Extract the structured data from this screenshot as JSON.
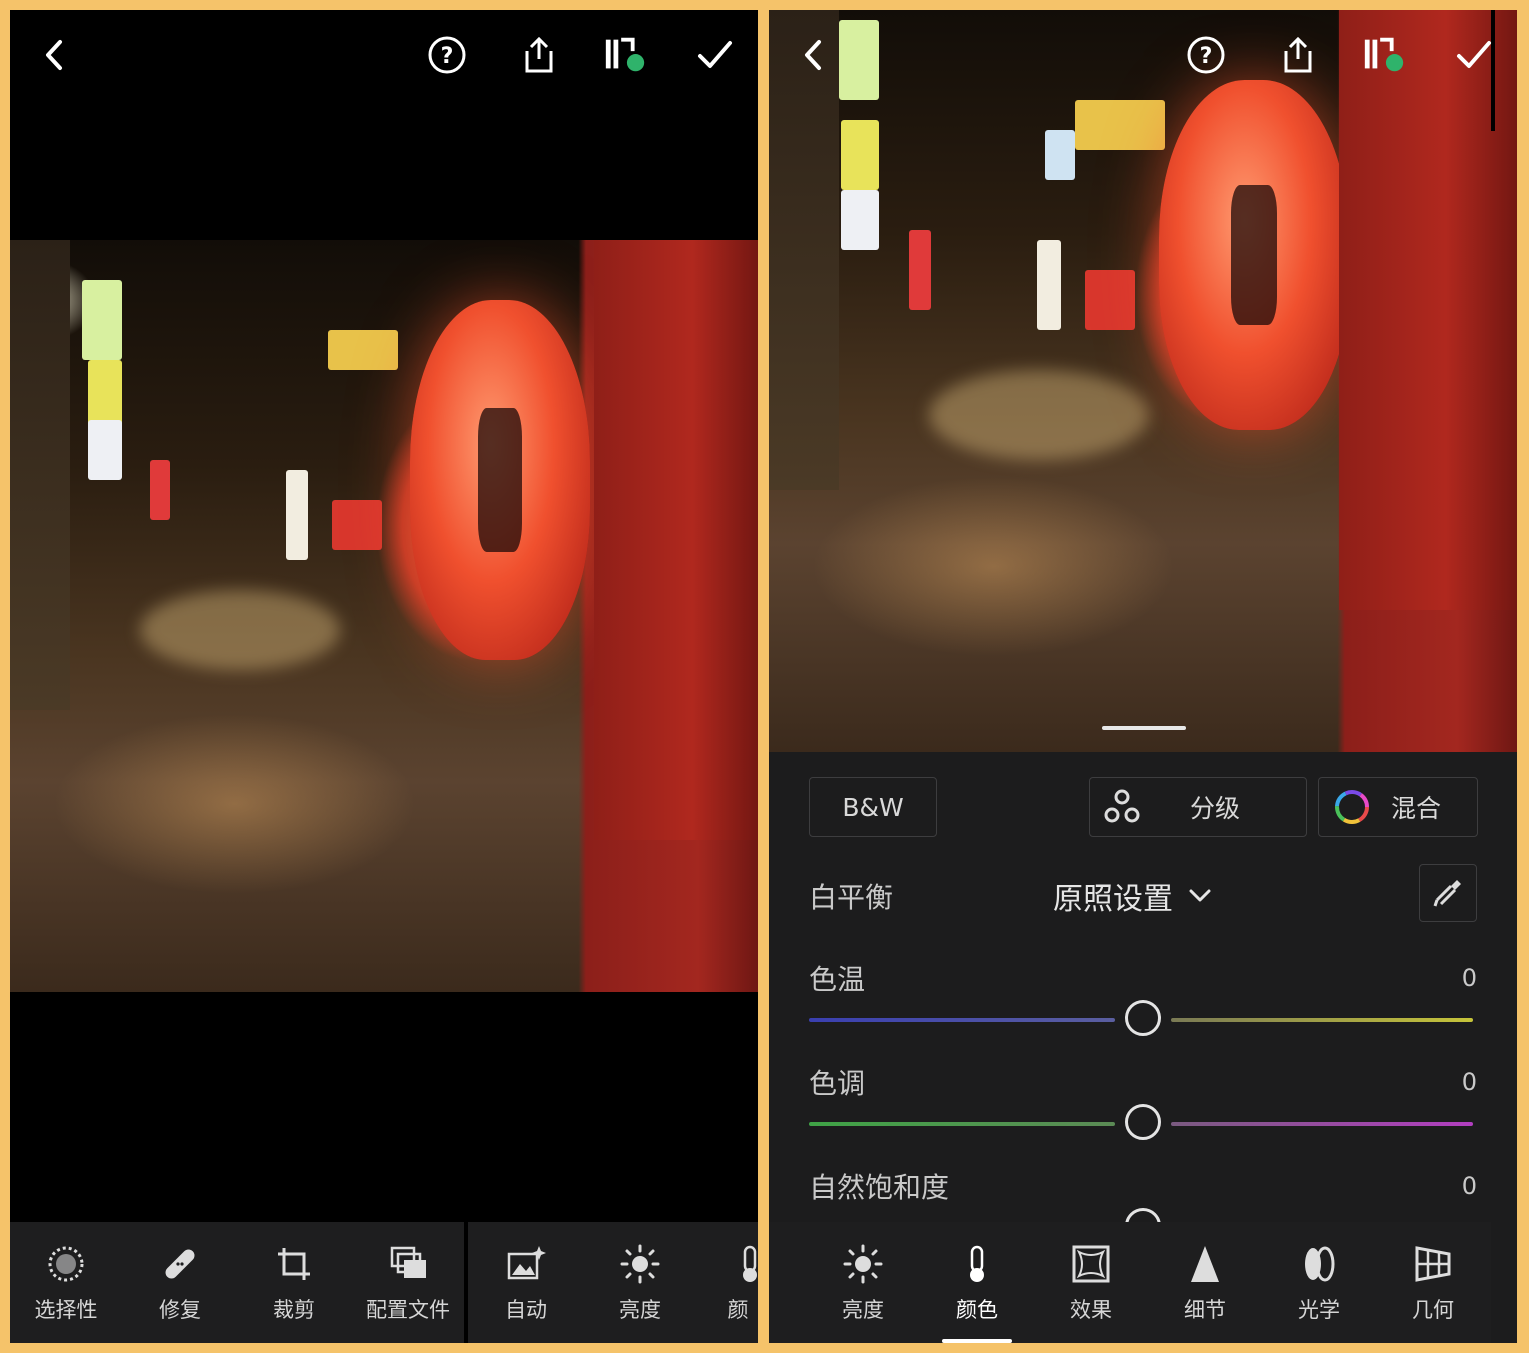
{
  "left": {
    "topbar": {
      "back_icon": "chevron-left-icon",
      "help_icon": "help-circle-icon",
      "share_icon": "share-icon",
      "compare_icon": "versions-icon",
      "confirm_icon": "checkmark-icon"
    },
    "tools": [
      {
        "label": "选择性",
        "icon": "selective-icon"
      },
      {
        "label": "修复",
        "icon": "bandage-icon"
      },
      {
        "label": "裁剪",
        "icon": "crop-icon"
      },
      {
        "label": "配置文件",
        "icon": "profiles-icon"
      },
      {
        "label": "自动",
        "icon": "auto-icon"
      },
      {
        "label": "亮度",
        "icon": "sun-icon"
      },
      {
        "label": "颜",
        "icon": "thermometer-icon"
      }
    ]
  },
  "right": {
    "topbar": {
      "back_icon": "chevron-left-icon",
      "help_icon": "help-circle-icon",
      "share_icon": "share-icon",
      "compare_icon": "versions-icon",
      "confirm_icon": "checkmark-icon"
    },
    "mode_buttons": {
      "bw": "B&W",
      "grading": "分级",
      "mix": "混合"
    },
    "white_balance": {
      "label": "白平衡",
      "value": "原照设置"
    },
    "sliders": [
      {
        "label": "色温",
        "value": "0",
        "level": 0
      },
      {
        "label": "色调",
        "value": "0",
        "level": 0
      },
      {
        "label": "自然饱和度",
        "value": "0",
        "level": 0
      }
    ],
    "tools": [
      {
        "label": "亮度",
        "icon": "sun-icon",
        "active": false
      },
      {
        "label": "颜色",
        "icon": "thermometer-icon",
        "active": true
      },
      {
        "label": "效果",
        "icon": "effects-icon",
        "active": false
      },
      {
        "label": "细节",
        "icon": "detail-triangle-icon",
        "active": false
      },
      {
        "label": "光学",
        "icon": "optics-icon",
        "active": false
      },
      {
        "label": "几何",
        "icon": "geometry-icon",
        "active": false
      }
    ]
  },
  "colors": {
    "frame": "#f5c36a",
    "panel": "#1c1c1d",
    "sync_dot": "#2fb36b"
  }
}
